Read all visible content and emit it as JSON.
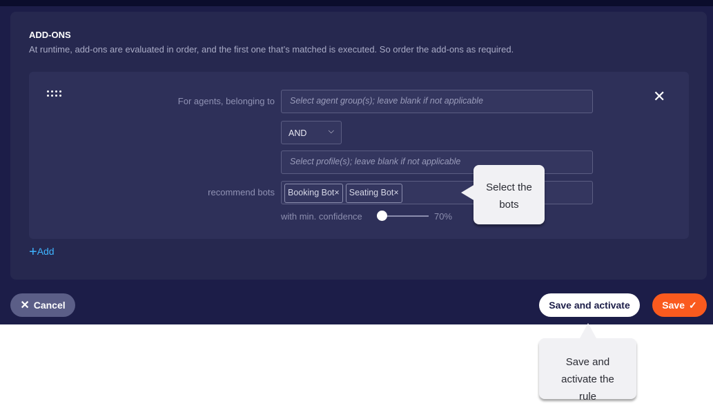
{
  "addons": {
    "title": "ADD-ONS",
    "description": "At runtime, add-ons are evaluated in order, and the first one that’s matched is executed. So order the add-ons as required.",
    "agents_label": "For agents, belonging to",
    "agent_group_placeholder": "Select agent group(s); leave blank if not applicable",
    "operator": "AND",
    "profile_placeholder": "Select profile(s); leave blank if not applicable",
    "bots_label": "recommend bots",
    "bots": [
      "Booking Bot",
      "Seating Bot"
    ],
    "chip_remove": "×",
    "confidence_label": "with min. confidence",
    "confidence_value": 70,
    "confidence_text": "70%",
    "add_label": "Add",
    "close": "✕"
  },
  "tooltips": {
    "bots": "Select the bots",
    "save_activate": "Save and activate the rule"
  },
  "footer": {
    "cancel": "Cancel",
    "save_activate": "Save and activate",
    "save": "Save"
  },
  "colors": {
    "accent": "#3fb4ff",
    "save": "#fa5a1e",
    "background": "#1c1d48"
  }
}
